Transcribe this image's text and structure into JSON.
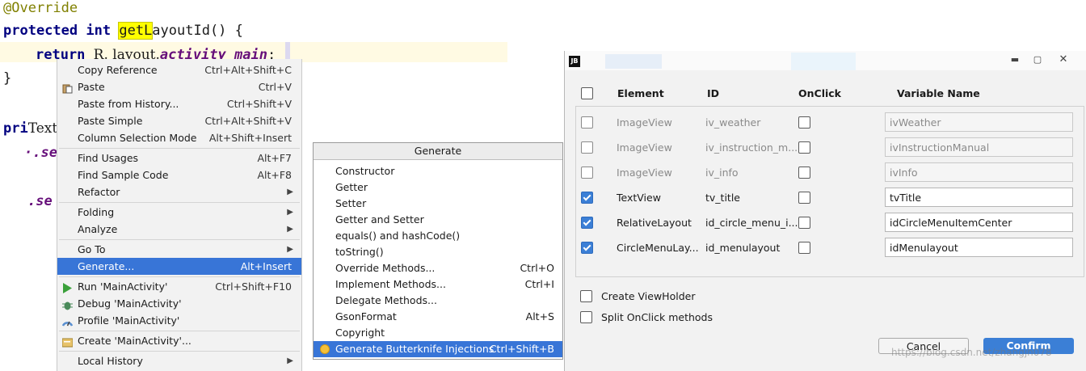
{
  "editor": {
    "line1": "@Override",
    "line2_kw1": "protected",
    "line2_kw2": "int",
    "line2_hl": "getL",
    "line2_rest": "ayoutId() {",
    "line3_kw": "return",
    "line3_plain": "R. layout.",
    "line3_field": "activity_main",
    "line3_end": ";",
    "line4": "}",
    "line5a": "pri",
    "line5b": "Text",
    "line6": "·.se",
    "line7": ".se"
  },
  "context_menu": {
    "items": [
      {
        "label": "Copy Reference",
        "shortcut": "Ctrl+Alt+Shift+C"
      },
      {
        "label": "Paste",
        "shortcut": "Ctrl+V"
      },
      {
        "label": "Paste from History...",
        "shortcut": "Ctrl+Shift+V"
      },
      {
        "label": "Paste Simple",
        "shortcut": "Ctrl+Alt+Shift+V"
      },
      {
        "label": "Column Selection Mode",
        "shortcut": "Alt+Shift+Insert"
      },
      {
        "label": "Find Usages",
        "shortcut": "Alt+F7"
      },
      {
        "label": "Find Sample Code",
        "shortcut": "Alt+F8"
      },
      {
        "label": "Refactor",
        "shortcut": ""
      },
      {
        "label": "Folding",
        "shortcut": ""
      },
      {
        "label": "Analyze",
        "shortcut": ""
      },
      {
        "label": "Go To",
        "shortcut": ""
      },
      {
        "label": "Generate...",
        "shortcut": "Alt+Insert"
      },
      {
        "label": "Run 'MainActivity'",
        "shortcut": "Ctrl+Shift+F10"
      },
      {
        "label": "Debug 'MainActivity'",
        "shortcut": ""
      },
      {
        "label": "Profile 'MainActivity'",
        "shortcut": ""
      },
      {
        "label": "Create 'MainActivity'...",
        "shortcut": ""
      },
      {
        "label": "Local History",
        "shortcut": ""
      }
    ]
  },
  "generate_popup": {
    "title": "Generate",
    "items": [
      {
        "label": "Constructor",
        "shortcut": ""
      },
      {
        "label": "Getter",
        "shortcut": ""
      },
      {
        "label": "Setter",
        "shortcut": ""
      },
      {
        "label": "Getter and Setter",
        "shortcut": ""
      },
      {
        "label": "equals() and hashCode()",
        "shortcut": ""
      },
      {
        "label": "toString()",
        "shortcut": ""
      },
      {
        "label": "Override Methods...",
        "shortcut": "Ctrl+O"
      },
      {
        "label": "Implement Methods...",
        "shortcut": "Ctrl+I"
      },
      {
        "label": "Delegate Methods...",
        "shortcut": ""
      },
      {
        "label": "GsonFormat",
        "shortcut": "Alt+S"
      },
      {
        "label": "Copyright",
        "shortcut": ""
      },
      {
        "label": "Generate Butterknife Injections",
        "shortcut": "Ctrl+Shift+B"
      }
    ]
  },
  "dialog": {
    "app_badge": "JB",
    "headers": {
      "element": "Element",
      "id": "ID",
      "onclick": "OnClick",
      "variable": "Variable Name"
    },
    "rows": [
      {
        "element": "ImageView",
        "id": "iv_weather",
        "variable": "ivWeather",
        "checked": false
      },
      {
        "element": "ImageView",
        "id": "iv_instruction_m...",
        "variable": "ivInstructionManual",
        "checked": false
      },
      {
        "element": "ImageView",
        "id": "iv_info",
        "variable": "ivInfo",
        "checked": false
      },
      {
        "element": "TextView",
        "id": "tv_title",
        "variable": "tvTitle",
        "checked": true
      },
      {
        "element": "RelativeLayout",
        "id": "id_circle_menu_i...",
        "variable": "idCircleMenuItemCenter",
        "checked": true
      },
      {
        "element": "CircleMenuLay...",
        "id": "id_menulayout",
        "variable": "idMenulayout",
        "checked": true
      }
    ],
    "option_viewholder": "Create ViewHolder",
    "option_split": "Split OnClick methods",
    "cancel_label": "Cancel",
    "confirm_label": "Confirm",
    "watermark": "https://blog.csdn.net/zhangjh078"
  },
  "colors": {
    "selection": "#3875d7",
    "confirm": "#3b7fd6"
  }
}
